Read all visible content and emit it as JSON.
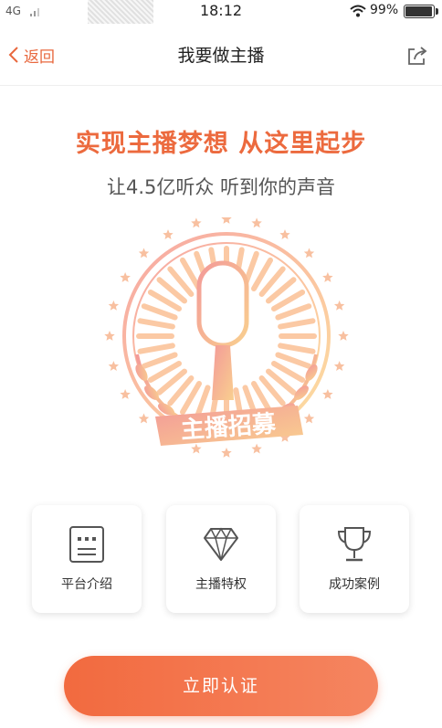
{
  "status_bar": {
    "network": "4G",
    "time": "18:12",
    "battery": "99%",
    "battery_level": 0.99
  },
  "nav": {
    "back_label": "返回",
    "title": "我要做主播",
    "back_icon": "chevron-left-icon",
    "share_icon": "share-icon"
  },
  "hero": {
    "headline": "实现主播梦想 从这里起步",
    "subheadline": "让4.5亿听众 听到你的声音",
    "emblem_text": "主播招募",
    "emblem_icon": "microphone-icon"
  },
  "features": [
    {
      "label": "平台介绍",
      "icon": "document-icon"
    },
    {
      "label": "主播特权",
      "icon": "diamond-icon"
    },
    {
      "label": "成功案例",
      "icon": "trophy-icon"
    }
  ],
  "cta": {
    "label": "立即认证"
  },
  "colors": {
    "accent": "#ec6a3e",
    "button_start": "#f26a3f",
    "button_end": "#f58560"
  }
}
